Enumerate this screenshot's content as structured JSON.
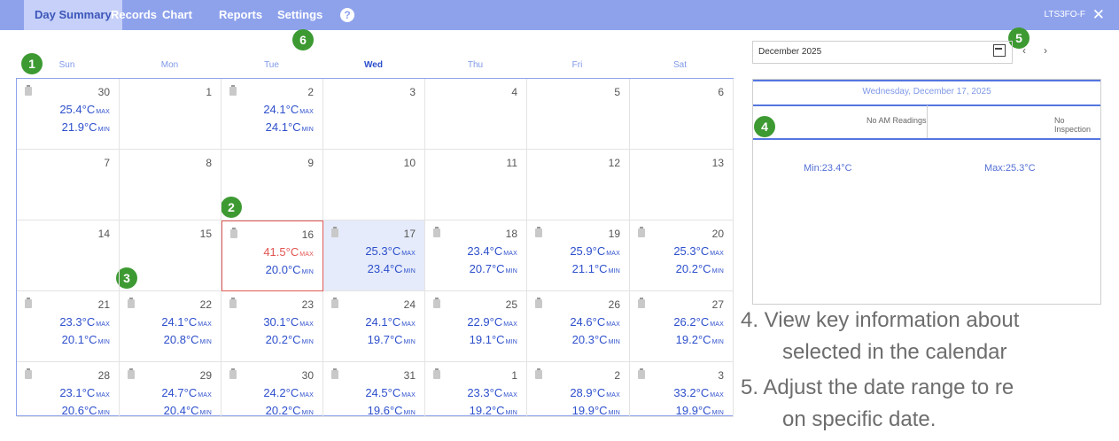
{
  "topbar": {
    "tabs": [
      "Day Summary",
      "Records",
      "Chart",
      "Reports",
      "Settings"
    ],
    "help": "?",
    "user": "LTS3FO-F",
    "close": "✕"
  },
  "badges": [
    "1",
    "2",
    "3",
    "4",
    "5",
    "6"
  ],
  "calendar": {
    "weekdays": [
      "Sun",
      "Mon",
      "Tue",
      "Wed",
      "Thu",
      "Fri",
      "Sat"
    ],
    "weeks": [
      [
        {
          "day": "30",
          "max": "25.4°C",
          "min": "21.9°C",
          "note": true
        },
        {
          "day": "1"
        },
        {
          "day": "2",
          "max": "24.1°C",
          "min": "24.1°C",
          "note": true
        },
        {
          "day": "3"
        },
        {
          "day": "4"
        },
        {
          "day": "5"
        },
        {
          "day": "6"
        }
      ],
      [
        {
          "day": "7"
        },
        {
          "day": "8"
        },
        {
          "day": "9"
        },
        {
          "day": "10"
        },
        {
          "day": "11"
        },
        {
          "day": "12"
        },
        {
          "day": "13"
        }
      ],
      [
        {
          "day": "14"
        },
        {
          "day": "15"
        },
        {
          "day": "16",
          "max": "41.5°C",
          "min": "20.0°C",
          "note": true,
          "alert": true
        },
        {
          "day": "17",
          "max": "25.3°C",
          "min": "23.4°C",
          "note": true,
          "selected": true
        },
        {
          "day": "18",
          "max": "23.4°C",
          "min": "20.7°C",
          "note": true
        },
        {
          "day": "19",
          "max": "25.9°C",
          "min": "21.1°C",
          "note": true
        },
        {
          "day": "20",
          "max": "25.3°C",
          "min": "20.2°C",
          "note": true
        }
      ],
      [
        {
          "day": "21",
          "max": "23.3°C",
          "min": "20.1°C",
          "note": true
        },
        {
          "day": "22",
          "max": "24.1°C",
          "min": "20.8°C",
          "note": true
        },
        {
          "day": "23",
          "max": "30.1°C",
          "min": "20.2°C",
          "note": true
        },
        {
          "day": "24",
          "max": "24.1°C",
          "min": "19.7°C",
          "note": true
        },
        {
          "day": "25",
          "max": "22.9°C",
          "min": "19.1°C",
          "note": true
        },
        {
          "day": "26",
          "max": "24.6°C",
          "min": "20.3°C",
          "note": true
        },
        {
          "day": "27",
          "max": "26.2°C",
          "min": "19.2°C",
          "note": true
        }
      ],
      [
        {
          "day": "28",
          "max": "23.1°C",
          "min": "20.6°C",
          "note": true
        },
        {
          "day": "29",
          "max": "24.7°C",
          "min": "20.4°C",
          "note": true
        },
        {
          "day": "30",
          "max": "24.2°C",
          "min": "20.2°C",
          "note": true
        },
        {
          "day": "31",
          "max": "24.5°C",
          "min": "19.6°C",
          "note": true
        },
        {
          "day": "1",
          "max": "23.3°C",
          "min": "19.2°C",
          "note": true
        },
        {
          "day": "2",
          "max": "28.9°C",
          "min": "19.9°C",
          "note": true
        },
        {
          "day": "3",
          "max": "33.2°C",
          "min": "19.9°C",
          "note": true
        }
      ]
    ],
    "max_unit": "MAX",
    "min_unit": "MIN"
  },
  "date_picker": {
    "value": "December 2025",
    "prev": "‹",
    "next": "›"
  },
  "detail_panel": {
    "date": "Wednesday, December 17, 2025",
    "am_readings": "No AM Readings",
    "inspection": "No Inspection",
    "min": "Min:23.4°C",
    "max": "Max:25.3°C"
  },
  "legend": [
    "4.  View key information about",
    "selected in the calendar",
    "5.  Adjust the date range to re",
    "on specific date."
  ],
  "colors": {
    "topbar": "#8ea2ec",
    "accent": "#2d4fcc",
    "alert": "#e25552",
    "badge": "#3d9a32"
  }
}
